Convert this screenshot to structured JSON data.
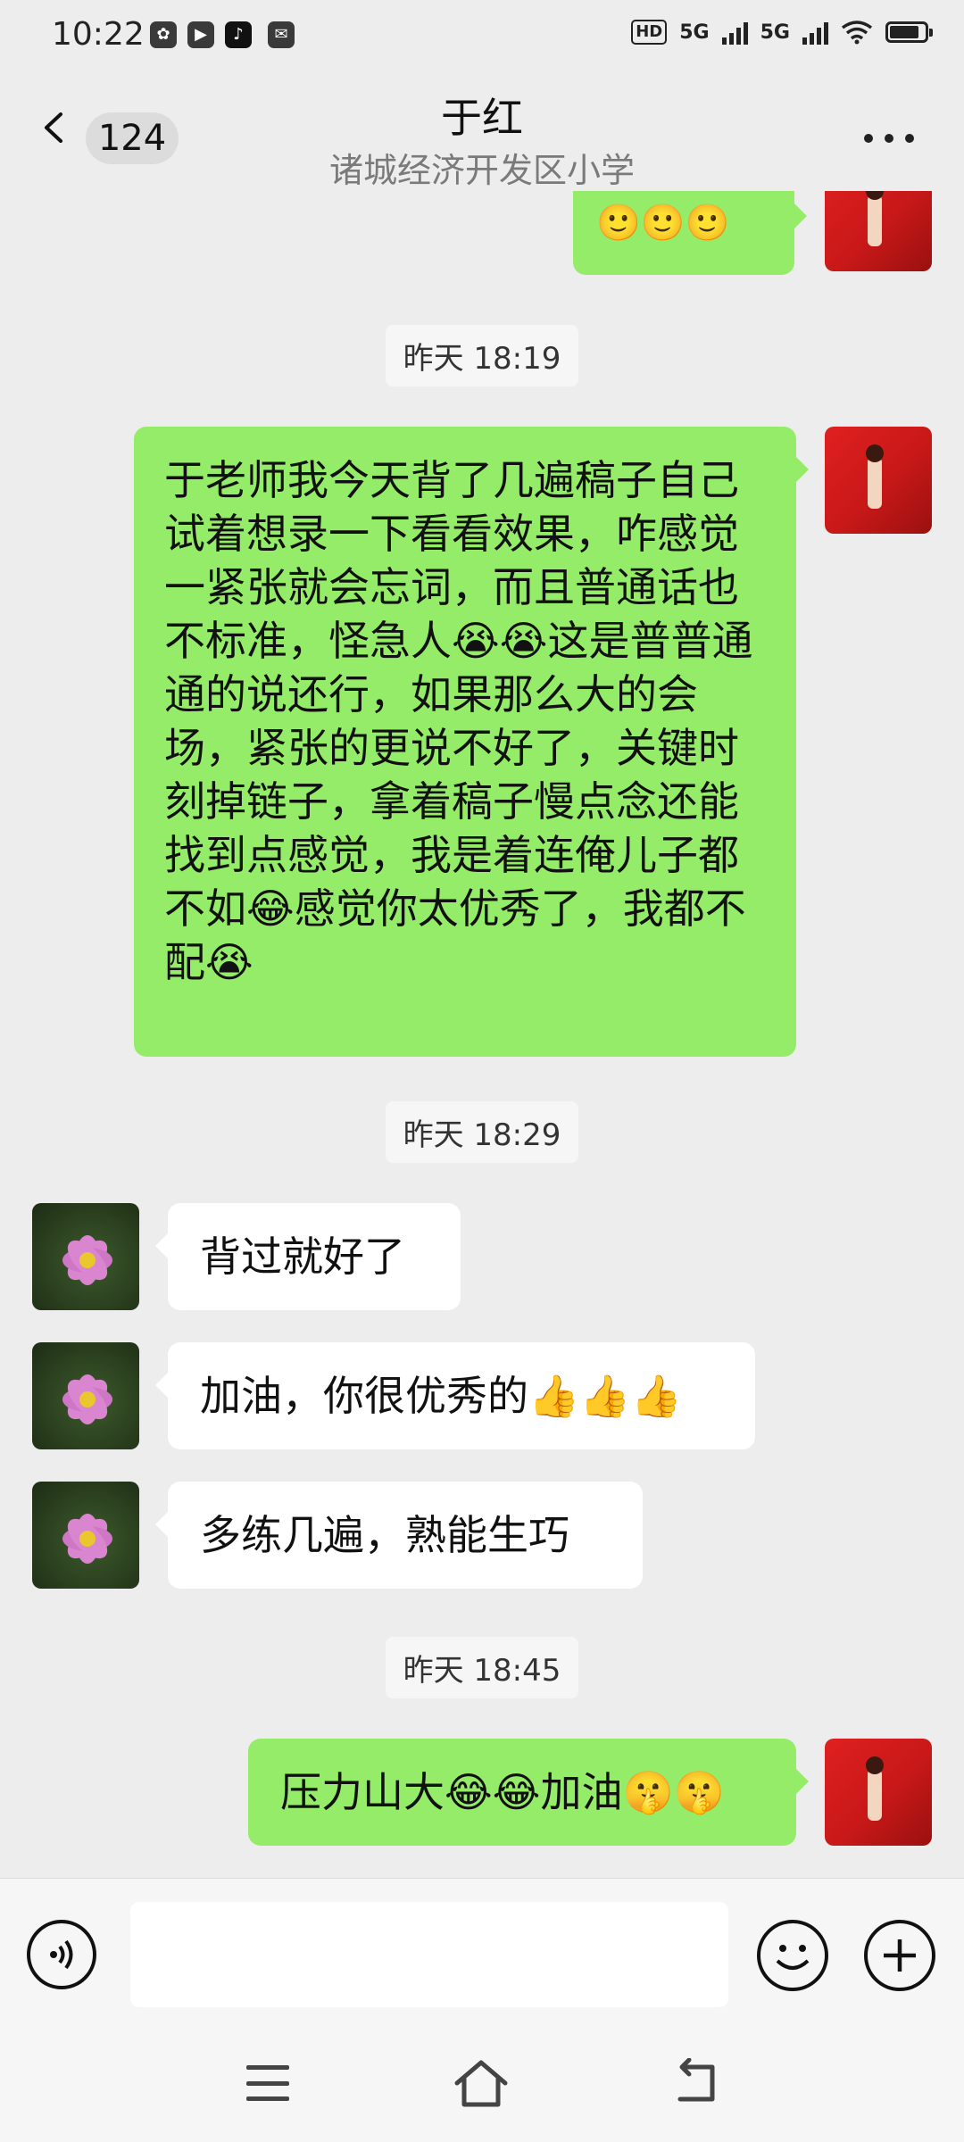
{
  "status_bar": {
    "time": "10:22",
    "hd_label": "HD",
    "net1": "5G",
    "net2": "5G",
    "battery_level": 0.85
  },
  "header": {
    "unread_count": "124",
    "title": "于红",
    "subtitle": "诸城经济开发区小学"
  },
  "messages": [
    {
      "side": "out",
      "text": "🙂🙂🙂",
      "partial": true
    },
    {
      "timestamp": "昨天 18:19"
    },
    {
      "side": "out",
      "text": "于老师我今天背了几遍稿子自己试着想录一下看看效果，咋感觉一紧张就会忘词，而且普通话也不标准，怪急人😭😭这是普普通通的说还行，如果那么大的会场，紧张的更说不好了，关键时刻掉链子，拿着稿子慢点念还能找到点感觉，我是着连俺儿子都不如😂感觉你太优秀了，我都不配😭"
    },
    {
      "timestamp": "昨天 18:29"
    },
    {
      "side": "in",
      "text": "背过就好了"
    },
    {
      "side": "in",
      "text": "加油，你很优秀的👍👍👍"
    },
    {
      "side": "in",
      "text": "多练几遍，熟能生巧"
    },
    {
      "timestamp": "昨天 18:45"
    },
    {
      "side": "out",
      "text": "压力山大😂😂加油🤫🤫"
    }
  ],
  "colors": {
    "bubble_out": "#95ec69",
    "bubble_in": "#ffffff",
    "background": "#ededed"
  },
  "icons": {
    "back": "chevron-left-icon",
    "more": "more-dots-icon",
    "voice": "voice-icon",
    "emoji": "emoji-icon",
    "plus": "plus-icon",
    "nav_menu": "menu-icon",
    "nav_home": "home-icon",
    "nav_back": "back-icon"
  }
}
